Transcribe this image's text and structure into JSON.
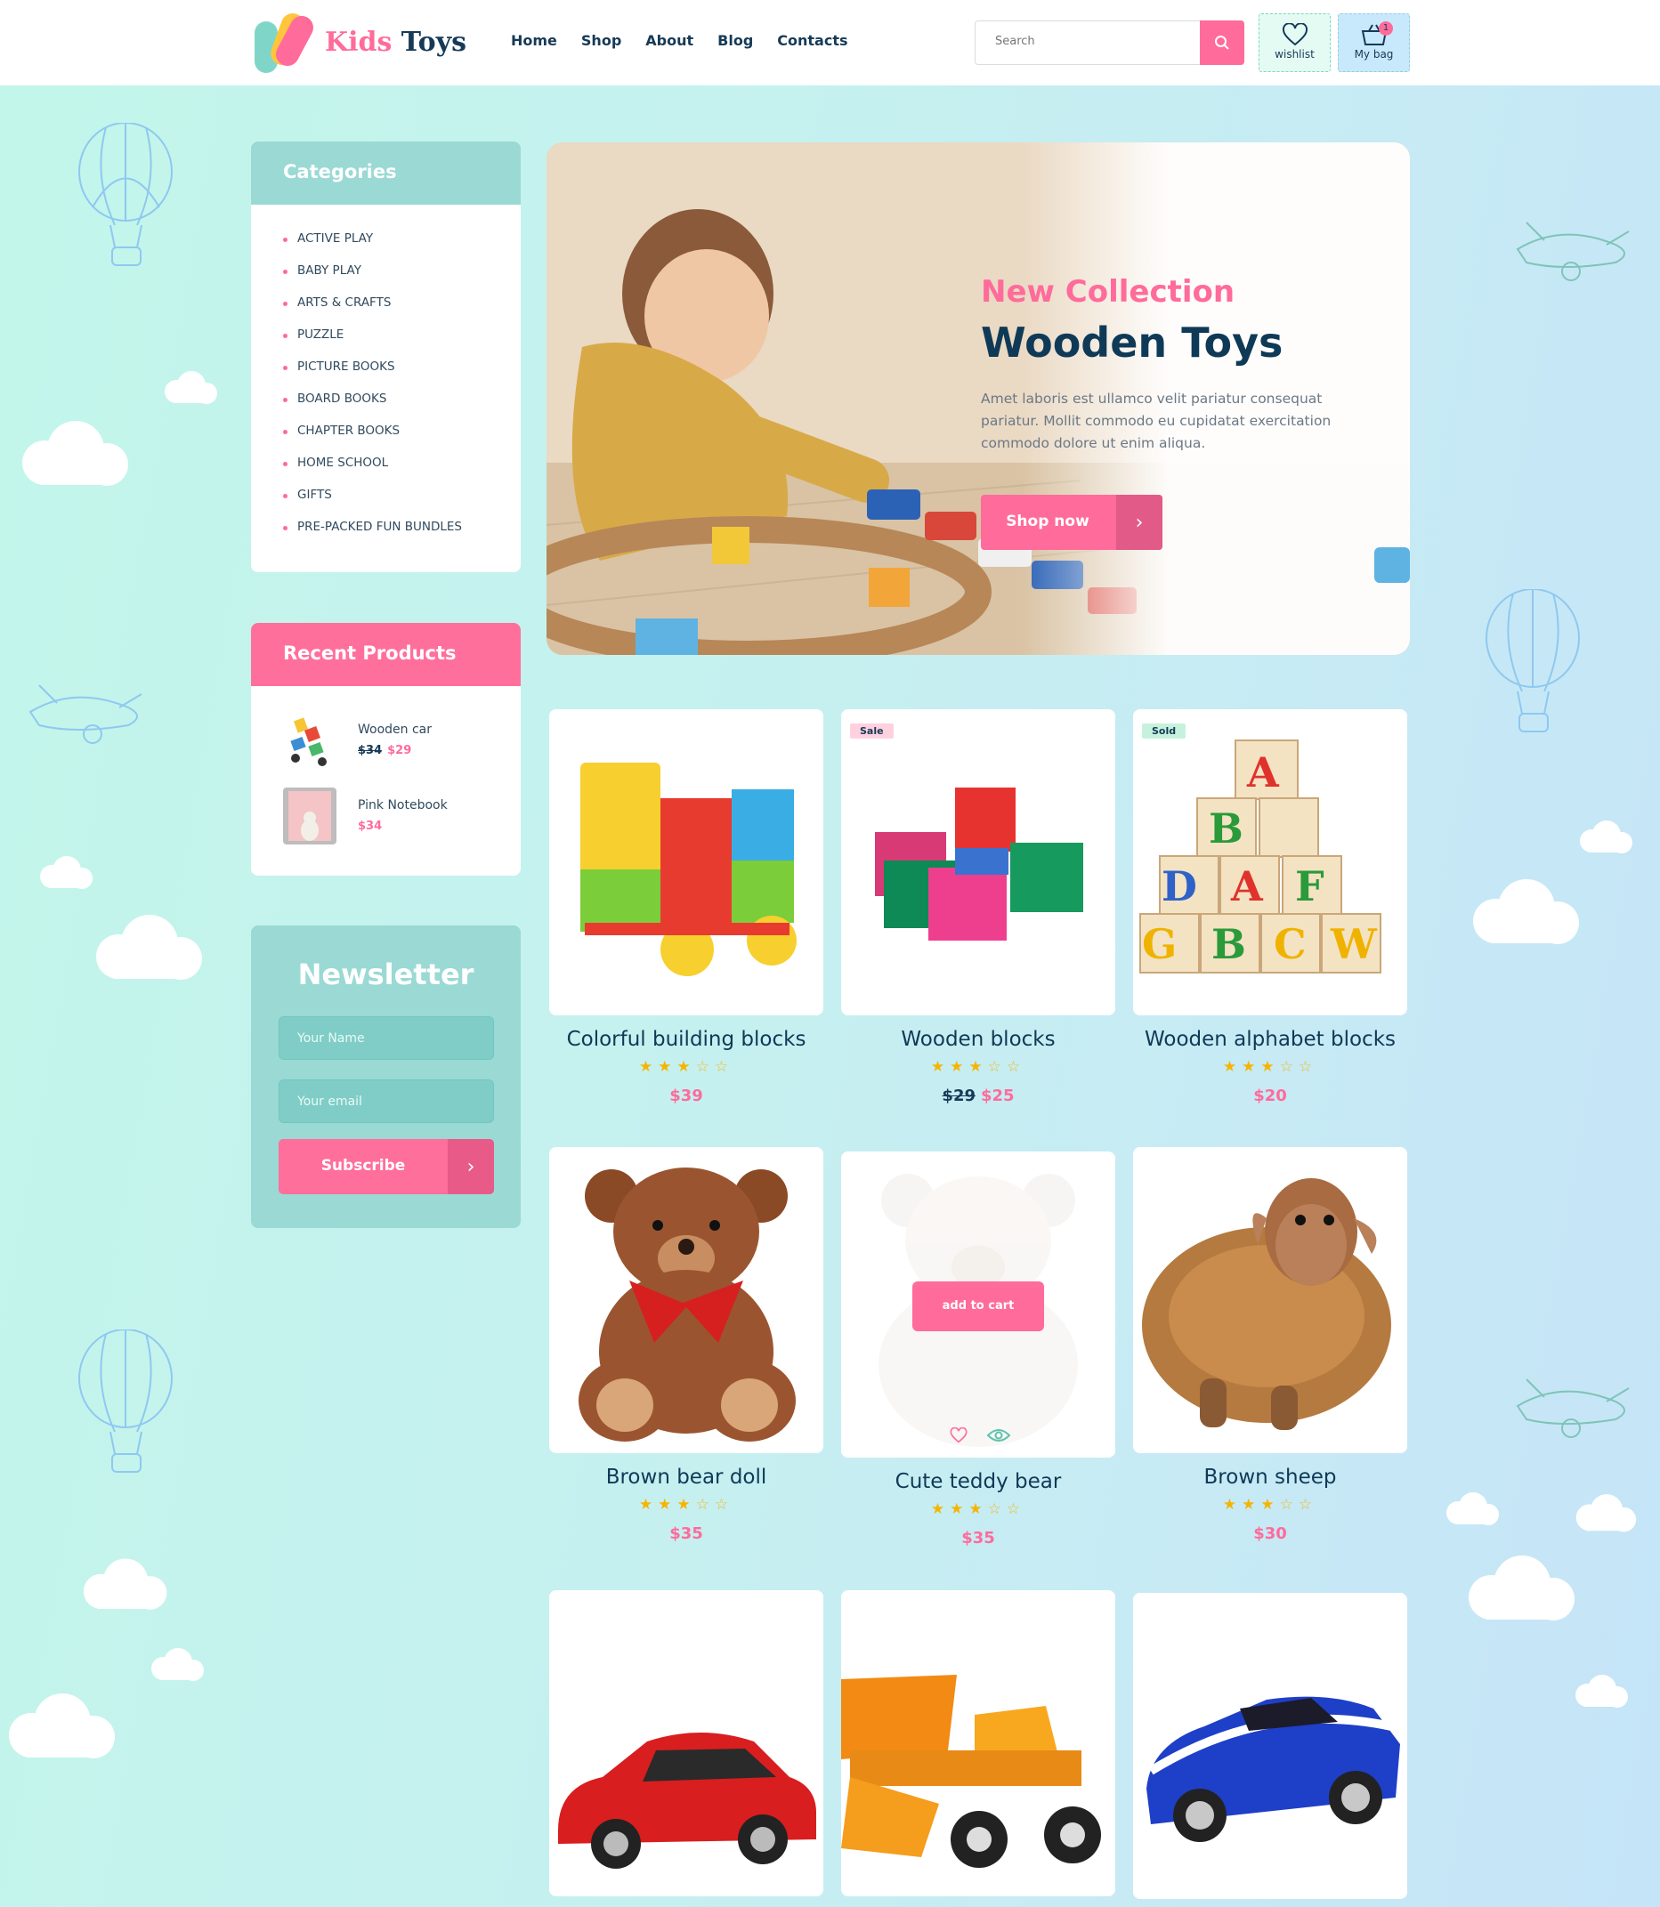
{
  "brand": {
    "part1": "Kids",
    "part2": "Toys"
  },
  "nav": [
    "Home",
    "Shop",
    "About",
    "Blog",
    "Contacts"
  ],
  "search": {
    "placeholder": "Search"
  },
  "wishlist": {
    "label": "wishlist"
  },
  "bag": {
    "label": "My bag",
    "count": "1"
  },
  "categories": {
    "title": "Categories",
    "items": [
      "Active play",
      "Baby play",
      "Arts & crafts",
      "Puzzle",
      "Picture books",
      "Board books",
      "Chapter books",
      "Home school",
      "Gifts",
      "Pre-packed fun bundles"
    ]
  },
  "recent": {
    "title": "Recent Products",
    "items": [
      {
        "name": "Wooden car",
        "old": "$34",
        "price": "$29"
      },
      {
        "name": "Pink Notebook",
        "old": "",
        "price": "$34"
      }
    ]
  },
  "newsletter": {
    "title": "Newsletter",
    "name_placeholder": "Your Name",
    "email_placeholder": "Your email",
    "button": "Subscribe"
  },
  "hero": {
    "subtitle": "New Collection",
    "title": "Wooden Toys",
    "text": "Amet laboris est ullamco velit pariatur consequat pariatur. Mollit commodo eu cupidatat exercitation commodo dolore ut enim aliqua.",
    "button": "Shop now"
  },
  "products": [
    {
      "title": "Colorful building blocks",
      "rating": 3,
      "old": "",
      "price": "$39",
      "tag": ""
    },
    {
      "title": "Wooden blocks",
      "rating": 3,
      "old": "$29",
      "price": "$25",
      "tag": "Sale"
    },
    {
      "title": "Wooden alphabet blocks",
      "rating": 3,
      "old": "",
      "price": "$20",
      "tag": "Sold"
    },
    {
      "title": "Brown bear doll",
      "rating": 3,
      "old": "",
      "price": "$35",
      "tag": ""
    },
    {
      "title": "Cute teddy bear",
      "rating": 3,
      "old": "",
      "price": "$35",
      "tag": "",
      "hover_action": "add to cart"
    },
    {
      "title": "Brown sheep",
      "rating": 3,
      "old": "",
      "price": "$30",
      "tag": ""
    },
    {
      "title": "",
      "rating": 0,
      "old": "",
      "price": "",
      "tag": ""
    },
    {
      "title": "",
      "rating": 0,
      "old": "",
      "price": "",
      "tag": ""
    },
    {
      "title": "",
      "rating": 0,
      "old": "",
      "price": "",
      "tag": ""
    }
  ],
  "colors": {
    "accent": "#ff6b9b",
    "teal": "#9ad9d4",
    "navy": "#0f3a57"
  }
}
